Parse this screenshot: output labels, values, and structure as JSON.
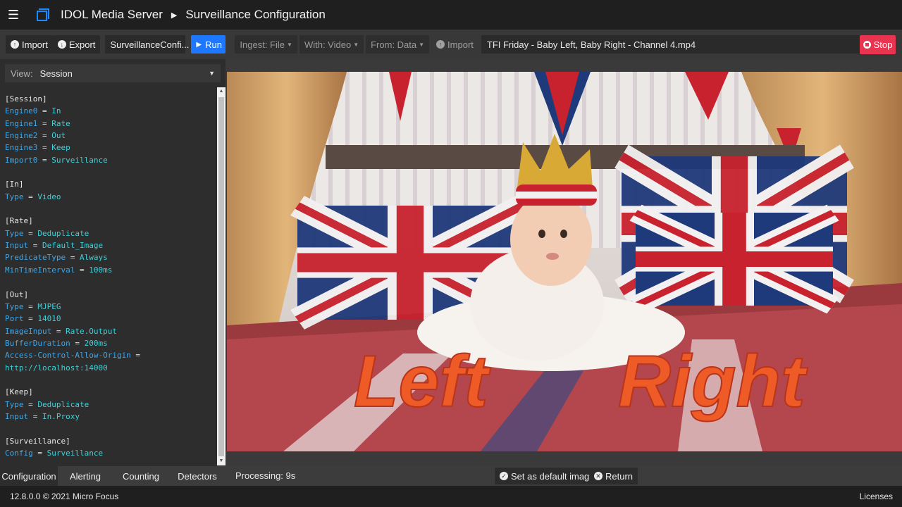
{
  "app": {
    "name": "IDOL Media Server",
    "page_title": "Surveillance Configuration"
  },
  "toolbar": {
    "import_label": "Import",
    "export_label": "Export",
    "config_name": "SurveillanceConfi...",
    "run_label": "Run",
    "ingest_label": "Ingest: File",
    "with_label": "With: Video",
    "from_label": "From: Data",
    "import2_label": "Import",
    "filename": "TFI Friday - Baby Left, Baby Right - Channel 4.mp4",
    "stop_label": "Stop"
  },
  "left_panel": {
    "view_label": "View:",
    "view_value": "Session",
    "config_lines": [
      {
        "type": "section",
        "text": "[Session]"
      },
      {
        "type": "kv",
        "key": "Engine0",
        "value": "In"
      },
      {
        "type": "kv",
        "key": "Engine1",
        "value": "Rate"
      },
      {
        "type": "kv",
        "key": "Engine2",
        "value": "Out"
      },
      {
        "type": "kv",
        "key": "Engine3",
        "value": "Keep"
      },
      {
        "type": "kv",
        "key": "Import0",
        "value": "Surveillance"
      },
      {
        "type": "blank"
      },
      {
        "type": "section",
        "text": "[In]"
      },
      {
        "type": "kv",
        "key": "Type",
        "value": "Video"
      },
      {
        "type": "blank"
      },
      {
        "type": "section",
        "text": "[Rate]"
      },
      {
        "type": "kv",
        "key": "Type",
        "value": "Deduplicate"
      },
      {
        "type": "kv",
        "key": "Input",
        "value": "Default_Image"
      },
      {
        "type": "kv",
        "key": "PredicateType",
        "value": "Always"
      },
      {
        "type": "kv",
        "key": "MinTimeInterval",
        "value": "100ms"
      },
      {
        "type": "blank"
      },
      {
        "type": "section",
        "text": "[Out]"
      },
      {
        "type": "kv",
        "key": "Type",
        "value": "MJPEG"
      },
      {
        "type": "kv",
        "key": "Port",
        "value": "14010"
      },
      {
        "type": "kv",
        "key": "ImageInput",
        "value": "Rate.Output"
      },
      {
        "type": "kv",
        "key": "BufferDuration",
        "value": "200ms"
      },
      {
        "type": "kv",
        "key": "Access-Control-Allow-Origin",
        "value": ""
      },
      {
        "type": "cont",
        "value": "http://localhost:14000"
      },
      {
        "type": "blank"
      },
      {
        "type": "section",
        "text": "[Keep]"
      },
      {
        "type": "kv",
        "key": "Type",
        "value": "Deduplicate"
      },
      {
        "type": "kv",
        "key": "Input",
        "value": "In.Proxy"
      },
      {
        "type": "blank"
      },
      {
        "type": "section",
        "text": "[Surveillance]"
      },
      {
        "type": "kv",
        "key": "Config",
        "value": "Surveillance"
      }
    ]
  },
  "video": {
    "caption_left": "Left",
    "caption_right": "Right"
  },
  "bottom": {
    "tabs": [
      "Configuration",
      "Alerting",
      "Counting",
      "Detectors"
    ],
    "processing": "Processing: 9s",
    "set_default_label": "Set as default image",
    "return_label": "Return"
  },
  "status": {
    "version": "12.8.0.0 © 2021 Micro Focus",
    "licenses": "Licenses"
  },
  "colors": {
    "accent_blue": "#1e78ff",
    "stop_red": "#e8344e",
    "code_key": "#3fa7e8",
    "code_value": "#3fd1d9"
  }
}
